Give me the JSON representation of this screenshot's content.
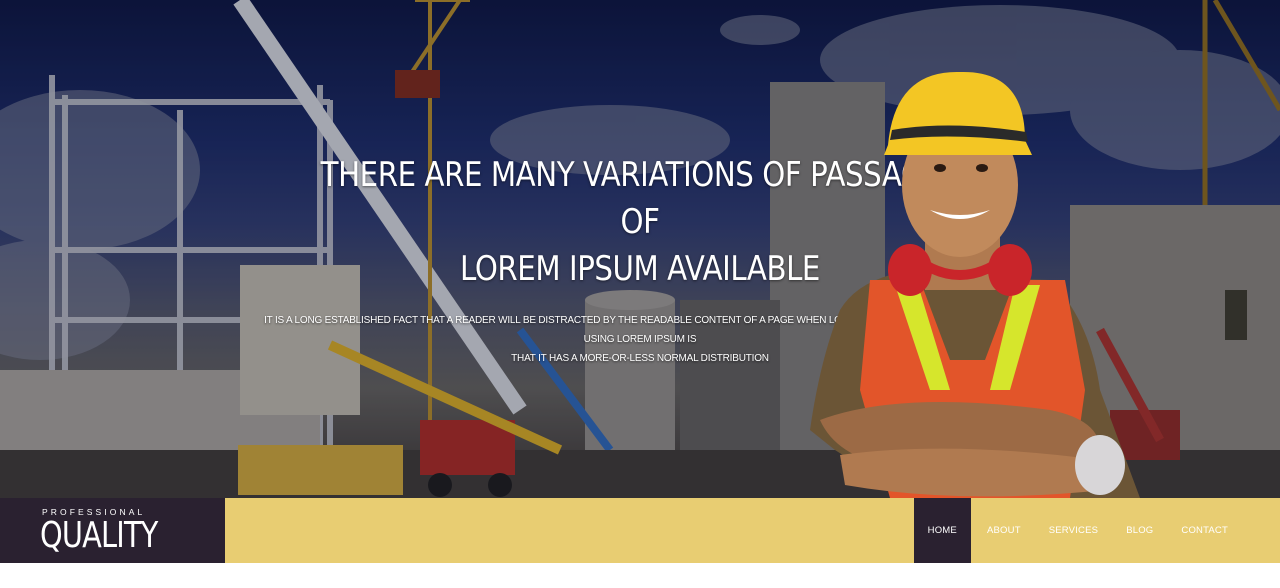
{
  "hero": {
    "title_line1": "THERE ARE MANY VARIATIONS OF PASSAGES OF",
    "title_line2": "LOREM IPSUM AVAILABLE",
    "subtitle_line1": "IT IS A LONG ESTABLISHED FACT THAT A READER WILL BE DISTRACTED BY THE READABLE CONTENT OF A PAGE WHEN LOOKING AT ITS LAYOUT. THE POINT OF USING LOREM IPSUM IS",
    "subtitle_line2": "THAT IT HAS A MORE-OR-LESS NORMAL DISTRIBUTION"
  },
  "logo": {
    "top": "PROFESSIONAL",
    "main": "QUALITY"
  },
  "nav": {
    "items": [
      {
        "label": "HOME",
        "active": true
      },
      {
        "label": "ABOUT",
        "active": false
      },
      {
        "label": "SERVICES",
        "active": false
      },
      {
        "label": "BLOG",
        "active": false
      },
      {
        "label": "CONTACT",
        "active": false
      }
    ]
  },
  "colors": {
    "nav_background": "#e8cd72",
    "logo_background": "#2a2130",
    "active_item": "#2a2130",
    "sky": "#1a2a63"
  }
}
